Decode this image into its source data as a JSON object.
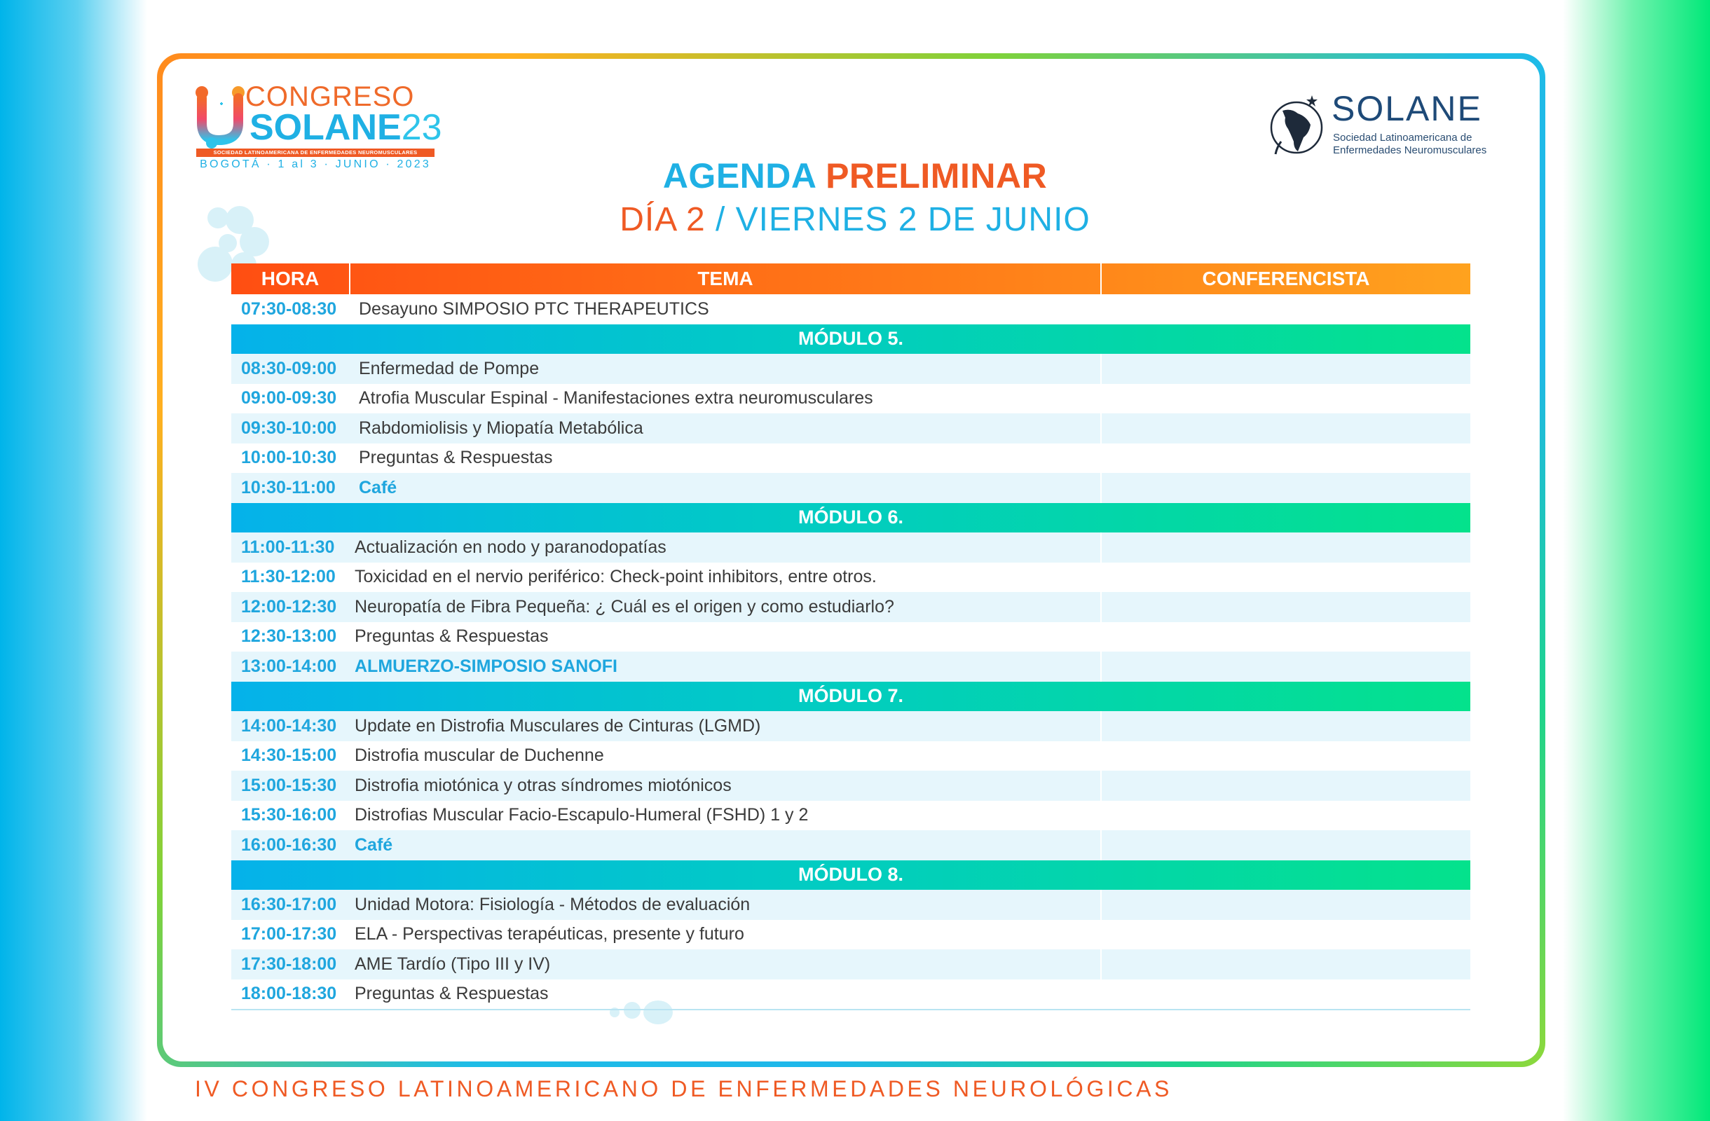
{
  "logo_left": {
    "line1": "CONGRESO",
    "line2": "SOLANE",
    "line2_year": "23",
    "band": "SOCIEDAD LATINOAMERICANA DE ENFERMEDADES NEUROMUSCULARES",
    "place": "BOGOTÁ · 1 al 3 · JUNIO · 2023"
  },
  "logo_right": {
    "name": "SOLANE",
    "sub1": "Sociedad Latinoamericana de",
    "sub2": "Enfermedades Neuromusculares"
  },
  "title": {
    "part1": "AGENDA",
    "part2": "PRELIMINAR",
    "day": "DÍA 2",
    "date": "/ VIERNES 2 DE JUNIO"
  },
  "table": {
    "headers": [
      "HORA",
      "TEMA",
      "CONFERENCISTA"
    ],
    "rows": [
      {
        "time": "07:30-08:30",
        "topic": "Desayuno SIMPOSIO PTC THERAPEUTICS"
      },
      {
        "module": "MÓDULO 5."
      },
      {
        "time": "08:30-09:00",
        "topic": "Enfermedad de Pompe"
      },
      {
        "time": "09:00-09:30",
        "topic": "Atrofia Muscular Espinal - Manifestaciones extra neuromusculares"
      },
      {
        "time": "09:30-10:00",
        "topic": "Rabdomiolisis y Miopatía Metabólica"
      },
      {
        "time": "10:00-10:30",
        "topic": "Preguntas & Respuestas"
      },
      {
        "time": "10:30-11:00",
        "topic": "Café"
      },
      {
        "module": "MÓDULO 6."
      },
      {
        "time": "11:00-11:30",
        "topic": "Actualización en nodo y paranodopatías"
      },
      {
        "time": "11:30-12:00",
        "topic": "Toxicidad en el nervio periférico: Check-point inhibitors, entre otros."
      },
      {
        "time": "12:00-12:30",
        "topic": "Neuropatía de Fibra Pequeña: ¿ Cuál es el origen y como estudiarlo?"
      },
      {
        "time": "12:30-13:00",
        "topic": "Preguntas & Respuestas"
      },
      {
        "time": "13:00-14:00",
        "topic": "ALMUERZO-SIMPOSIO SANOFI"
      },
      {
        "module": "MÓDULO 7."
      },
      {
        "time": "14:00-14:30",
        "topic": "Update en Distrofia Musculares de Cinturas (LGMD)"
      },
      {
        "time": "14:30-15:00",
        "topic": "Distrofia muscular de Duchenne"
      },
      {
        "time": "15:00-15:30",
        "topic": "Distrofia miotónica y otras síndromes miotónicos"
      },
      {
        "time": "15:30-16:00",
        "topic": "Distrofias Muscular Facio-Escapulo-Humeral (FSHD) 1 y 2"
      },
      {
        "time": "16:00-16:30",
        "topic": "Café"
      },
      {
        "module": "MÓDULO 8."
      },
      {
        "time": "16:30-17:00",
        "topic": "Unidad Motora:  Fisiología - Métodos de evaluación"
      },
      {
        "time": "17:00-17:30",
        "topic": "ELA - Perspectivas terapéuticas, presente y futuro"
      },
      {
        "time": "17:30-18:00",
        "topic": "AME Tardío (Tipo III y IV)"
      },
      {
        "time": "18:00-18:30",
        "topic": "Preguntas & Respuestas"
      }
    ]
  },
  "footer": "IV CONGRESO LATINOAMERICANO DE ENFERMEDADES NEUROLÓGICAS"
}
